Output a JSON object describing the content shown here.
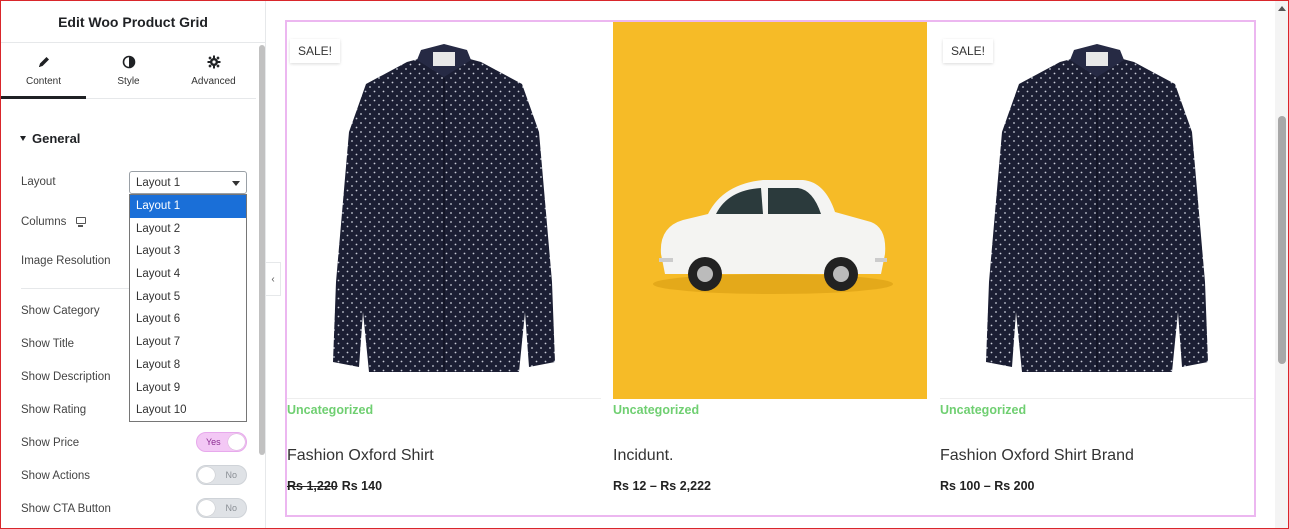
{
  "editor": {
    "title": "Edit Woo Product Grid",
    "tabs": [
      {
        "label": "Content",
        "icon": "pencil-icon",
        "active": true
      },
      {
        "label": "Style",
        "icon": "half-circle-icon",
        "active": false
      },
      {
        "label": "Advanced",
        "icon": "gear-icon",
        "active": false
      }
    ],
    "section": "General",
    "controls": {
      "layout_label": "Layout",
      "layout_value": "Layout 1",
      "columns_label": "Columns",
      "image_resolution_label": "Image Resolution",
      "show_category_label": "Show Category",
      "show_title_label": "Show Title",
      "show_description_label": "Show Description",
      "show_rating_label": "Show Rating",
      "show_price_label": "Show Price",
      "show_actions_label": "Show Actions",
      "show_cta_label": "Show CTA Button"
    },
    "layout_options": [
      "Layout 1",
      "Layout 2",
      "Layout 3",
      "Layout 4",
      "Layout 5",
      "Layout 6",
      "Layout 7",
      "Layout 8",
      "Layout 9",
      "Layout 10"
    ],
    "toggles": {
      "show_price": "Yes",
      "show_actions": "No",
      "show_cta": "No"
    }
  },
  "products": [
    {
      "sale_badge": "SALE!",
      "category": "Uncategorized",
      "title": "Fashion Oxford Shirt",
      "price_old": "Rs 1,220",
      "price": "Rs 140",
      "image": "navy-polka-dot-shirt"
    },
    {
      "sale_badge": "",
      "category": "Uncategorized",
      "title": "Incidunt.",
      "price_old": "",
      "price": "Rs 12 – Rs 2,222",
      "image": "white-car-on-yellow"
    },
    {
      "sale_badge": "SALE!",
      "category": "Uncategorized",
      "title": "Fashion Oxford Shirt Brand",
      "price_old": "",
      "price": "Rs 100 – Rs 200",
      "image": "navy-polka-dot-shirt"
    }
  ],
  "colors": {
    "category": "#6fcf71",
    "toggle_on": "#f3c8f5",
    "selected_option": "#1a6fd8",
    "grid_outline": "#ecb7f0",
    "car_background": "#f6bb27"
  }
}
